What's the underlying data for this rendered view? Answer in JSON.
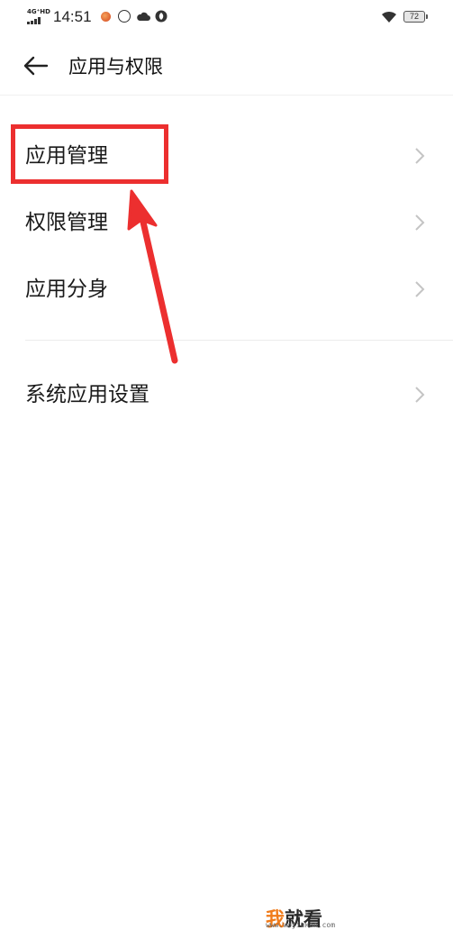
{
  "status_bar": {
    "network": "4G⁺HD",
    "time": "14:51",
    "battery": "72",
    "icons": [
      "notification-dot-icon",
      "data-saver-icon",
      "weather-cloud-icon",
      "app-leaf-icon",
      "wifi-icon",
      "battery-icon"
    ]
  },
  "header": {
    "title": "应用与权限",
    "back_icon": "back-arrow-icon"
  },
  "menu": {
    "items": [
      {
        "label": "应用管理",
        "icon": "chevron-right-icon"
      },
      {
        "label": "权限管理",
        "icon": "chevron-right-icon"
      },
      {
        "label": "应用分身",
        "icon": "chevron-right-icon"
      },
      {
        "label": "系统应用设置",
        "icon": "chevron-right-icon"
      }
    ]
  },
  "annotation": {
    "color": "#ec2f2f"
  },
  "watermark": {
    "logo_first": "我",
    "logo_rest": "就看",
    "url": "www.wojiukan.com"
  }
}
